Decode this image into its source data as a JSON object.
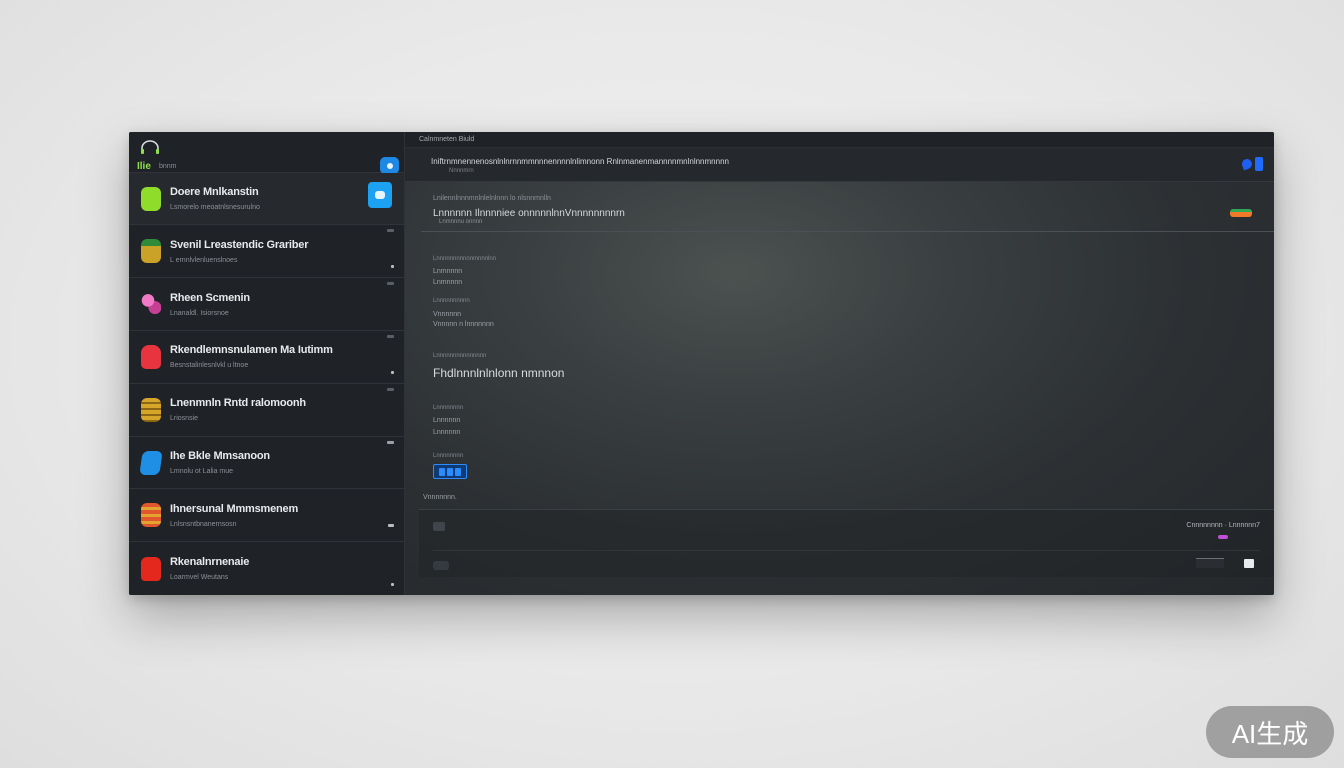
{
  "sidebar": {
    "brand": "Ilie",
    "brand_sub": "bnnm",
    "items": [
      {
        "title": "Doere Mnlkanstin",
        "subtitle": "Lsmorelo meoatnlsnesurulno",
        "icon_color": "#8fdc2a",
        "icon": "leaf-icon"
      },
      {
        "title": "Svenil Lreastendic Grariber",
        "subtitle": "L ernnlvlenluenslnoes",
        "icon_color": "#c9a227",
        "icon": "stack-icon"
      },
      {
        "title": "Rheen Scmenin",
        "subtitle": "Lnanaldl. Isiorsnoe",
        "icon_color": "#e056a8",
        "icon": "flower-icon"
      },
      {
        "title": "Rkendlemnsnulamen Ma Iutimm",
        "subtitle": "Besnstalinlesnlvkl u ltnoe",
        "icon_color": "#e8343f",
        "icon": "cup-icon"
      },
      {
        "title": "Lnenmnln Rntd ralomoonh",
        "subtitle": "Lriosnsie",
        "icon_color": "#d6a62b",
        "icon": "coins-icon"
      },
      {
        "title": "Ihe Bkle Mmsanoon",
        "subtitle": "Lmnolu ot Lalia mue",
        "icon_color": "#1f8fe6",
        "icon": "badge-icon"
      },
      {
        "title": "Ihnersunal Mmmsmenem",
        "subtitle": "Lnlsnsntbnanernsosn",
        "icon_color": "#e2562e",
        "icon": "layers-icon"
      },
      {
        "title": "Rkenalnrnenaie",
        "subtitle": "Loarmvel Weutans",
        "icon_color": "#e5281e",
        "icon": "jar-icon"
      }
    ]
  },
  "main": {
    "top_title": "Calnmneten Biuld",
    "header_title": "Iniftrnmnennenosnlnlnrnnmmnnnennnnlnlimnonn Rnlnmanenmannnnmnlnlnnmnnnn",
    "header_sub": "Nnnnmrn",
    "field_label": "Lnilennlnnnmnlnlelnlnnn lo nlsnnmnlln",
    "field_value": "Lnnnnnn Ilnnnniee onnnnnlnnVnnnnnnnnrn",
    "field_hint": "Lnmnnnu onnnn",
    "details": [
      {
        "label": "Lnnnnnnnnnnnmnnnlnn",
        "value": "Lnmnnnn",
        "value2": "Lnmnnnn"
      },
      {
        "label": "Lnnnnnnnnnn",
        "value": "Vnnnnnn",
        "value2": "Vnnnnn n lnnnnnnn"
      },
      {
        "label": "Lnnnnnnnnnnnnnnn",
        "big": "Fhdlnnnlnlnlonn nmnnon"
      },
      {
        "label": "Lnnnnnnnn",
        "value": "Lnnnnnn",
        "value2": "Lnnnnnn"
      },
      {
        "label": "Lnnnnnnnn"
      }
    ],
    "status": "Vnnnnnnn.",
    "bottom_right": "Cnnnnnnnn · Lnnnnnn7"
  },
  "watermark": "AI生成"
}
